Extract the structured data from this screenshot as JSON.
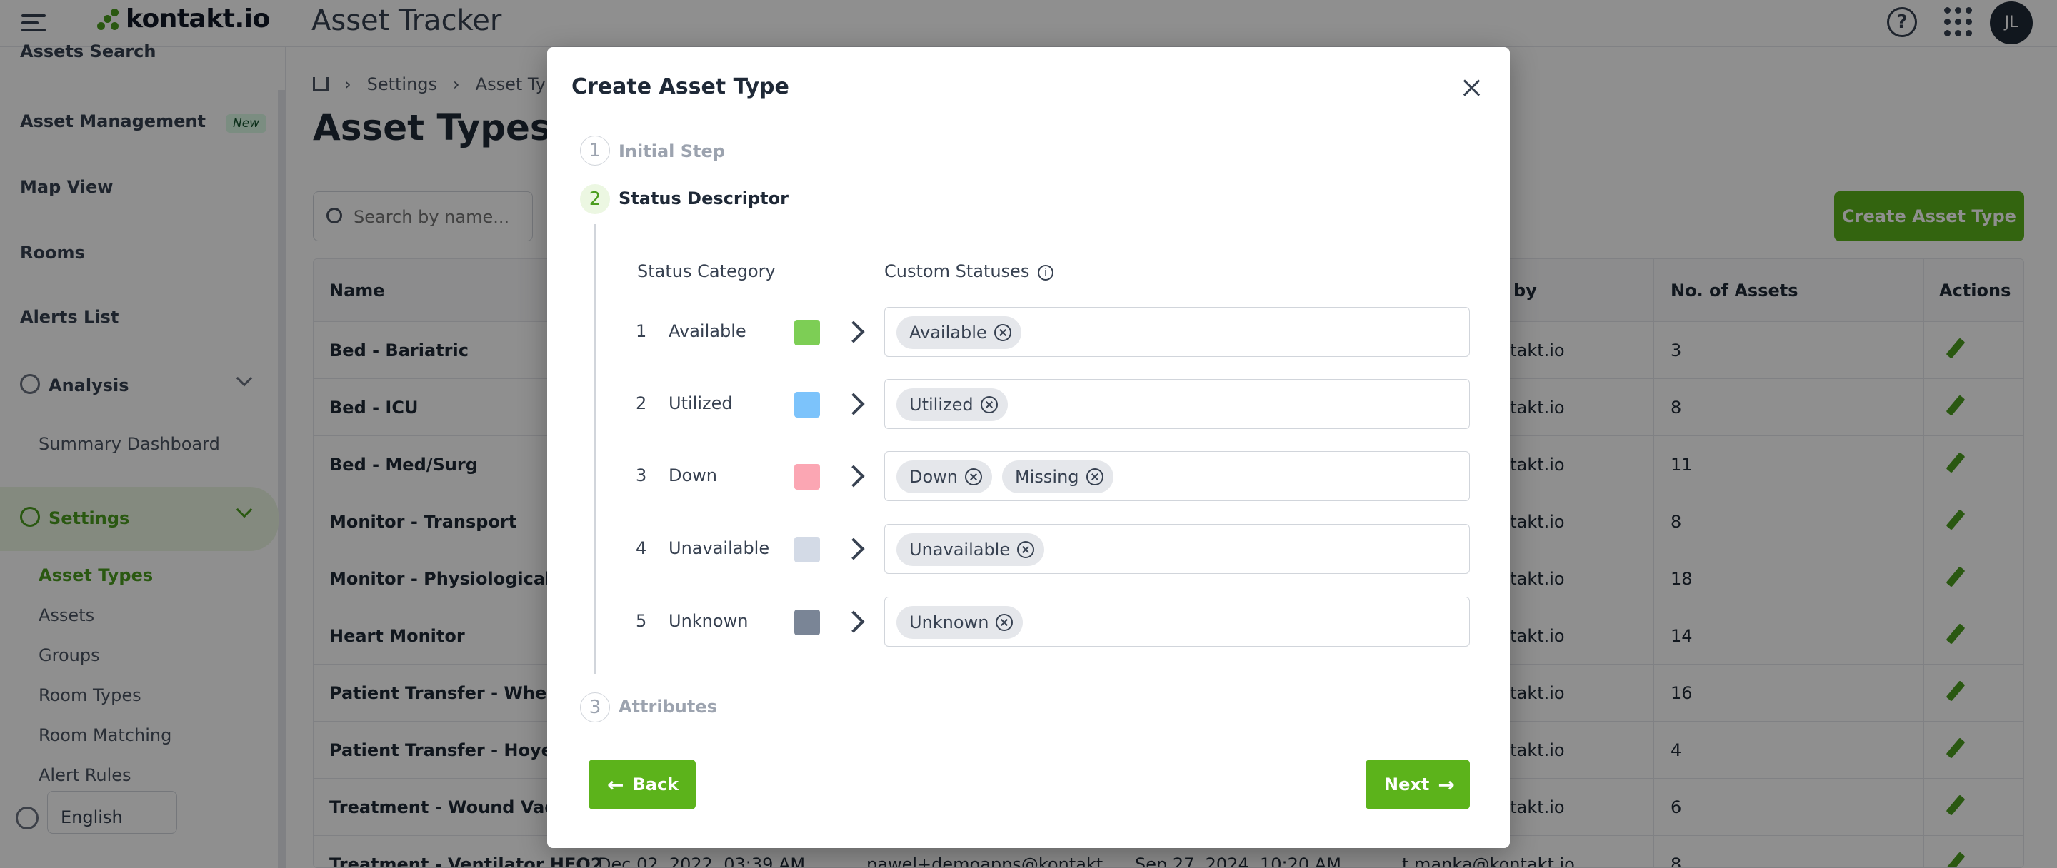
{
  "header": {
    "brand": "kontakt.io",
    "app_title": "Asset Tracker",
    "help": "?",
    "avatar_initials": "JL"
  },
  "sidebar": {
    "items": [
      {
        "label": "Assets Search"
      },
      {
        "label": "Asset Management",
        "badge": "New"
      },
      {
        "label": "Map View"
      },
      {
        "label": "Rooms"
      },
      {
        "label": "Alerts List"
      },
      {
        "label": "Analysis"
      },
      {
        "label": "Summary Dashboard"
      },
      {
        "label": "Settings"
      }
    ],
    "settings_sub": [
      "Asset Types",
      "Assets",
      "Groups",
      "Room Types",
      "Room Matching",
      "Alert Rules"
    ],
    "language": "English"
  },
  "main": {
    "breadcrumb": [
      "Settings",
      "Asset Types"
    ],
    "title": "Asset Types",
    "search_placeholder": "Search by name...",
    "create_button": "Create Asset Type",
    "columns": {
      "name": "Name",
      "by": "by",
      "count": "No. of Assets",
      "actions": "Actions"
    },
    "rows": [
      {
        "name": "Bed - Bariatric",
        "by": "ntakt.io",
        "count": "3"
      },
      {
        "name": "Bed - ICU",
        "by": "ntakt.io",
        "count": "8"
      },
      {
        "name": "Bed - Med/Surg",
        "by": "ntakt.io",
        "count": "11"
      },
      {
        "name": "Monitor - Transport",
        "by": "ntakt.io",
        "count": "8"
      },
      {
        "name": "Monitor - Physiological",
        "by": "ntakt.io",
        "count": "18"
      },
      {
        "name": "Heart Monitor",
        "by": "ntakt.io",
        "count": "14"
      },
      {
        "name": "Patient Transfer - Wheelch",
        "by": "ntakt.io",
        "count": "16"
      },
      {
        "name": "Patient Transfer - Hoyer Lift",
        "by": "ntakt.io",
        "count": "4"
      },
      {
        "name": "Treatment - Wound Vacs",
        "by": "ntakt.io",
        "count": "6"
      },
      {
        "name": "Treatment - Ventilator HFO2",
        "created": "Dec 02, 2022, 03:39 AM",
        "creator": "pawel+demoapps@kontakt...",
        "updated": "Sep 27, 2024, 10:20 AM",
        "by": "t.manka@kontakt.io",
        "count": "8"
      }
    ]
  },
  "modal": {
    "title": "Create Asset Type",
    "steps": [
      {
        "num": "1",
        "label": "Initial Step"
      },
      {
        "num": "2",
        "label": "Status Descriptor"
      },
      {
        "num": "3",
        "label": "Attributes"
      }
    ],
    "col_category": "Status Category",
    "col_custom": "Custom Statuses",
    "statuses": [
      {
        "idx": "1",
        "name": "Available",
        "color": "#7dce55",
        "tags": [
          "Available"
        ]
      },
      {
        "idx": "2",
        "name": "Utilized",
        "color": "#7cc3fb",
        "tags": [
          "Utilized"
        ]
      },
      {
        "idx": "3",
        "name": "Down",
        "color": "#fba6b3",
        "tags": [
          "Down",
          "Missing"
        ]
      },
      {
        "idx": "4",
        "name": "Unavailable",
        "color": "#d3dae6",
        "tags": [
          "Unavailable"
        ]
      },
      {
        "idx": "5",
        "name": "Unknown",
        "color": "#7a8596",
        "tags": [
          "Unknown"
        ]
      }
    ],
    "back_label": "Back",
    "next_label": "Next"
  }
}
